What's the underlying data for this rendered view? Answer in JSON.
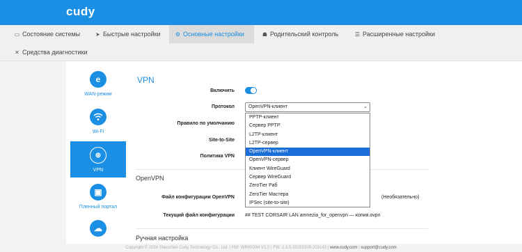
{
  "brand": {
    "logo": "cudy"
  },
  "nav": {
    "tabs": [
      {
        "label": "Состояние системы",
        "icon": "desktop-icon"
      },
      {
        "label": "Быстрые настройки",
        "icon": "rocket-icon"
      },
      {
        "label": "Основные настройки",
        "icon": "gear-icon",
        "active": true
      },
      {
        "label": "Родительский контроль",
        "icon": "family-icon"
      },
      {
        "label": "Расширенные настройки",
        "icon": "sliders-icon"
      },
      {
        "label": "Средства диагностики",
        "icon": "tools-icon"
      }
    ]
  },
  "sidebar": {
    "items": [
      {
        "label": "WAN-режим",
        "icon": "internet-explorer-icon"
      },
      {
        "label": "Wi-Fi",
        "icon": "wifi-icon"
      },
      {
        "label": "VPN",
        "icon": "vpn-globe-icon",
        "active": true
      },
      {
        "label": "Пленный портал",
        "icon": "portal-icon"
      },
      {
        "label": "",
        "icon": "cloud-upload-icon"
      }
    ]
  },
  "vpn": {
    "title": "VPN",
    "enable_label": "Включить",
    "enabled": true,
    "protocol_label": "Протокол",
    "protocol_value": "OpenVPN-клиент",
    "default_rule_label": "Правило по умолчанию",
    "site_to_site_label": "Site-to-Site",
    "policy_label": "Политика VPN",
    "protocol_options": [
      "PPTP-клиент",
      "Сервер PPTP",
      "L2TP-клиент",
      "L2TP-сервер",
      "OpenVPN-клиент",
      "OpenVPN-сервер",
      "Клиент WireGuard",
      "Сервер WireGuard",
      "ZeroTier Раб",
      "ZeroTier Мастера",
      "IPSec (site-to-site)"
    ],
    "selected_option_index": 4
  },
  "openvpn": {
    "section_title": "OpenVPN",
    "config_file_label": "Файл конфигурации OpenVPN",
    "optional_note": "(Необязательно)",
    "current_file_label": "Текущий файл конфигурации",
    "current_file_value": "## TEST CORSAIR LAN amnezia_for_openvpn — копия.ovpn"
  },
  "manual": {
    "section_title": "Ручная настройка"
  },
  "footer": {
    "copyright": "Copyright © 2024 Shenzhen Cudy Technology Co., Ltd.",
    "hw": "HW: WR6500H V1.0",
    "fw": "FW: 2.3.5-20250108-203143",
    "website": "www.cudy.com",
    "email": "support@cudy.com",
    "separator": "|"
  },
  "colors": {
    "accent": "#1a8fe3",
    "selected_option": "#1a6ed8"
  }
}
